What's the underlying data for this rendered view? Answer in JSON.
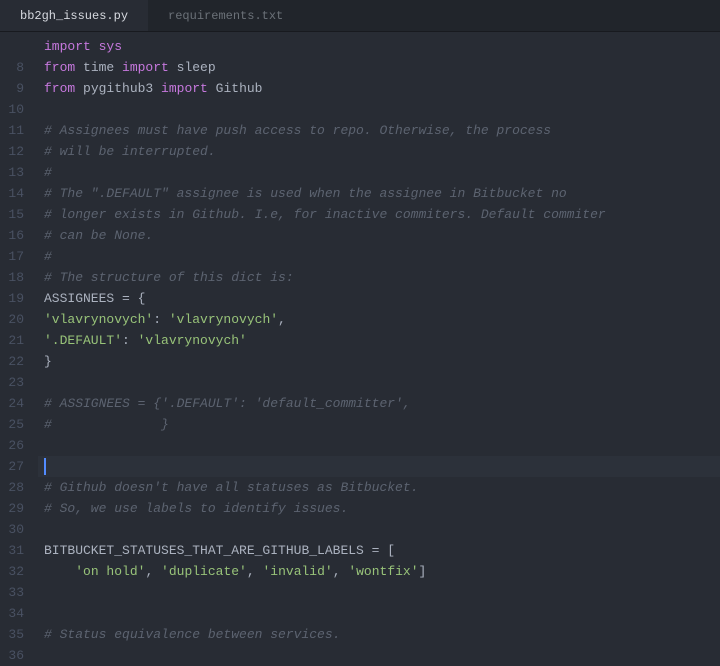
{
  "tabs": [
    {
      "label": "bb2gh_issues.py",
      "active": true
    },
    {
      "label": "requirements.txt",
      "active": false
    }
  ],
  "lines": [
    {
      "n": "",
      "tokens": [
        {
          "cls": "k-import",
          "t": "import sys"
        }
      ]
    },
    {
      "n": "8",
      "tokens": [
        {
          "cls": "k-from",
          "t": "from"
        },
        {
          "cls": "plain",
          "t": " time "
        },
        {
          "cls": "k-import",
          "t": "import"
        },
        {
          "cls": "plain",
          "t": " sleep"
        }
      ]
    },
    {
      "n": "9",
      "tokens": [
        {
          "cls": "k-from",
          "t": "from"
        },
        {
          "cls": "plain",
          "t": " pygithub3 "
        },
        {
          "cls": "k-import",
          "t": "import"
        },
        {
          "cls": "plain",
          "t": " Github"
        }
      ]
    },
    {
      "n": "10",
      "tokens": []
    },
    {
      "n": "11",
      "tokens": [
        {
          "cls": "comment",
          "t": "# Assignees must have push access to repo. Otherwise, the process"
        }
      ]
    },
    {
      "n": "12",
      "tokens": [
        {
          "cls": "comment",
          "t": "# will be interrupted."
        }
      ]
    },
    {
      "n": "13",
      "tokens": [
        {
          "cls": "comment",
          "t": "#"
        }
      ]
    },
    {
      "n": "14",
      "tokens": [
        {
          "cls": "comment",
          "t": "# The \".DEFAULT\" assignee is used when the assignee in Bitbucket no"
        }
      ]
    },
    {
      "n": "15",
      "tokens": [
        {
          "cls": "comment",
          "t": "# longer exists in Github. I.e, for inactive commiters. Default commiter"
        }
      ]
    },
    {
      "n": "16",
      "tokens": [
        {
          "cls": "comment",
          "t": "# can be None."
        }
      ]
    },
    {
      "n": "17",
      "tokens": [
        {
          "cls": "comment",
          "t": "#"
        }
      ]
    },
    {
      "n": "18",
      "tokens": [
        {
          "cls": "comment",
          "t": "# The structure of this dict is:"
        }
      ]
    },
    {
      "n": "19",
      "tokens": [
        {
          "cls": "plain",
          "t": "ASSIGNEES "
        },
        {
          "cls": "punct",
          "t": "= {"
        }
      ]
    },
    {
      "n": "20",
      "tokens": [
        {
          "cls": "str",
          "t": "'vlavrynovych'"
        },
        {
          "cls": "punct",
          "t": ": "
        },
        {
          "cls": "str",
          "t": "'vlavrynovych'"
        },
        {
          "cls": "punct",
          "t": ","
        }
      ]
    },
    {
      "n": "21",
      "tokens": [
        {
          "cls": "str",
          "t": "'.DEFAULT'"
        },
        {
          "cls": "punct",
          "t": ": "
        },
        {
          "cls": "str",
          "t": "'vlavrynovych'"
        }
      ]
    },
    {
      "n": "22",
      "tokens": [
        {
          "cls": "punct",
          "t": "}"
        }
      ]
    },
    {
      "n": "23",
      "tokens": []
    },
    {
      "n": "24",
      "tokens": [
        {
          "cls": "comment",
          "t": "# ASSIGNEES = {'.DEFAULT': 'default_committer',"
        }
      ]
    },
    {
      "n": "25",
      "tokens": [
        {
          "cls": "comment",
          "t": "#              }"
        }
      ]
    },
    {
      "n": "26",
      "tokens": []
    },
    {
      "n": "27",
      "cursor": true,
      "tokens": []
    },
    {
      "n": "28",
      "tokens": [
        {
          "cls": "comment",
          "t": "# Github doesn't have all statuses as Bitbucket."
        }
      ]
    },
    {
      "n": "29",
      "tokens": [
        {
          "cls": "comment",
          "t": "# So, we use labels to identify issues."
        }
      ]
    },
    {
      "n": "30",
      "tokens": []
    },
    {
      "n": "31",
      "tokens": [
        {
          "cls": "plain",
          "t": "BITBUCKET_STATUSES_THAT_ARE_GITHUB_LABELS "
        },
        {
          "cls": "punct",
          "t": "= ["
        }
      ]
    },
    {
      "n": "32",
      "tokens": [
        {
          "cls": "plain",
          "t": "    "
        },
        {
          "cls": "str",
          "t": "'on hold'"
        },
        {
          "cls": "punct",
          "t": ", "
        },
        {
          "cls": "str",
          "t": "'duplicate'"
        },
        {
          "cls": "punct",
          "t": ", "
        },
        {
          "cls": "str",
          "t": "'invalid'"
        },
        {
          "cls": "punct",
          "t": ", "
        },
        {
          "cls": "str",
          "t": "'wontfix'"
        },
        {
          "cls": "punct",
          "t": "]"
        }
      ]
    },
    {
      "n": "33",
      "tokens": []
    },
    {
      "n": "34",
      "tokens": []
    },
    {
      "n": "35",
      "tokens": [
        {
          "cls": "comment",
          "t": "# Status equivalence between services."
        }
      ]
    },
    {
      "n": "36",
      "tokens": []
    }
  ]
}
